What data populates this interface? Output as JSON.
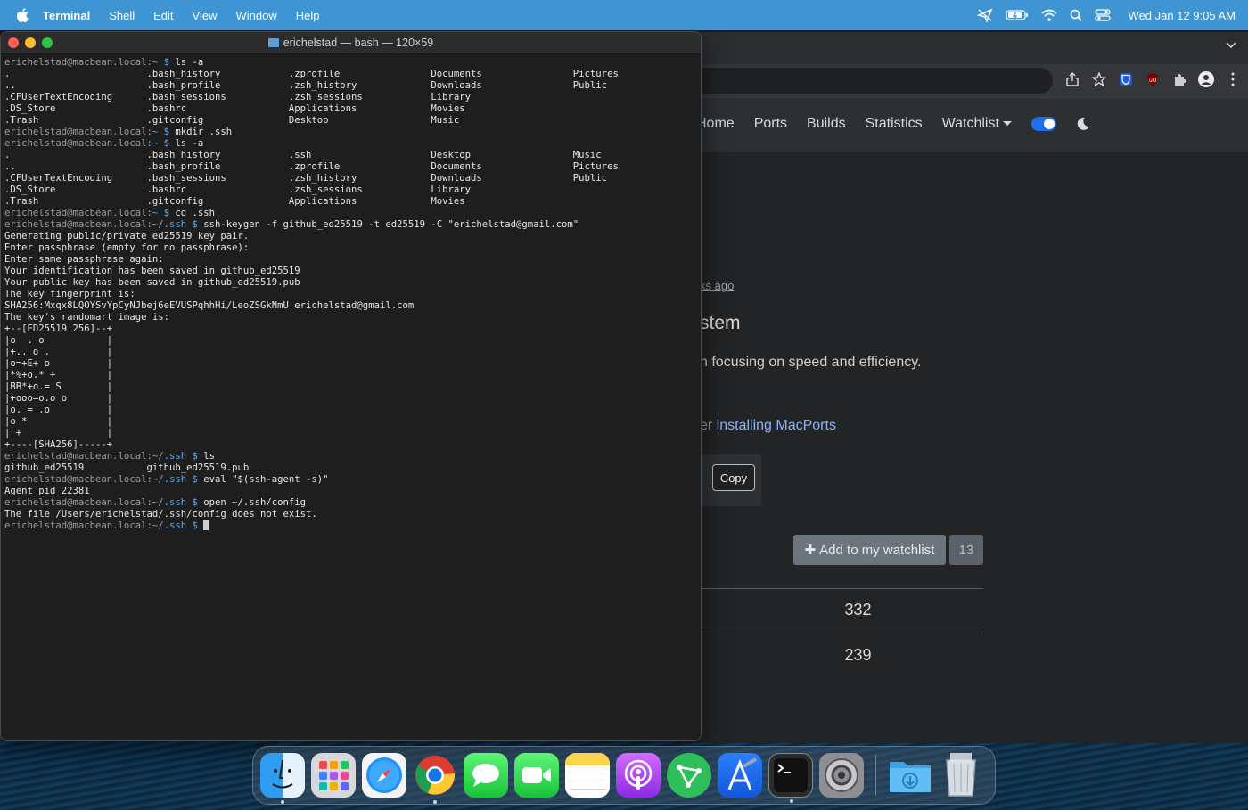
{
  "menubar": {
    "app_name": "Terminal",
    "items": [
      "Shell",
      "Edit",
      "View",
      "Window",
      "Help"
    ],
    "clock": "Wed Jan 12  9:05 AM",
    "status_icons": [
      "location-icon",
      "battery-icon",
      "wifi-icon",
      "search-icon",
      "control-center-icon"
    ]
  },
  "terminal": {
    "title": "erichelstad — bash — 120×59",
    "prompt_home_host": "erichelstad@macbean.local:",
    "lines": [
      {
        "type": "cmd",
        "path": "~",
        "cmd": "ls -a"
      },
      {
        "type": "out",
        "text": ".                        .bash_history            .zprofile                Documents                Pictures"
      },
      {
        "type": "out",
        "text": "..                       .bash_profile            .zsh_history             Downloads                Public"
      },
      {
        "type": "out",
        "text": ".CFUserTextEncoding      .bash_sessions           .zsh_sessions            Library"
      },
      {
        "type": "out",
        "text": ".DS_Store                .bashrc                  Applications             Movies"
      },
      {
        "type": "out",
        "text": ".Trash                   .gitconfig               Desktop                  Music"
      },
      {
        "type": "cmd",
        "path": "~",
        "cmd": "mkdir .ssh"
      },
      {
        "type": "cmd",
        "path": "~",
        "cmd": "ls -a"
      },
      {
        "type": "out",
        "text": ".                        .bash_history            .ssh                     Desktop                  Music"
      },
      {
        "type": "out",
        "text": "..                       .bash_profile            .zprofile                Documents                Pictures"
      },
      {
        "type": "out",
        "text": ".CFUserTextEncoding      .bash_sessions           .zsh_history             Downloads                Public"
      },
      {
        "type": "out",
        "text": ".DS_Store                .bashrc                  .zsh_sessions            Library"
      },
      {
        "type": "out",
        "text": ".Trash                   .gitconfig               Applications             Movies"
      },
      {
        "type": "cmd",
        "path": "~",
        "cmd": "cd .ssh"
      },
      {
        "type": "cmd",
        "path": "~/.ssh",
        "cmd": "ssh-keygen -f github_ed25519 -t ed25519 -C \"erichelstad@gmail.com\""
      },
      {
        "type": "out",
        "text": "Generating public/private ed25519 key pair."
      },
      {
        "type": "out",
        "text": "Enter passphrase (empty for no passphrase):"
      },
      {
        "type": "out",
        "text": "Enter same passphrase again:"
      },
      {
        "type": "out",
        "text": "Your identification has been saved in github_ed25519"
      },
      {
        "type": "out",
        "text": "Your public key has been saved in github_ed25519.pub"
      },
      {
        "type": "out",
        "text": "The key fingerprint is:"
      },
      {
        "type": "out",
        "text": "SHA256:Mxqx8LQOYSvYpCyNJbej6eEVUSPqhhHi/LeoZSGkNmU erichelstad@gmail.com"
      },
      {
        "type": "out",
        "text": "The key's randomart image is:"
      },
      {
        "type": "out",
        "text": "+--[ED25519 256]--+"
      },
      {
        "type": "out",
        "text": "|o  . o           |"
      },
      {
        "type": "out",
        "text": "|+.. o .          |"
      },
      {
        "type": "out",
        "text": "|o=+E+ o          |"
      },
      {
        "type": "out",
        "text": "|*%+o.* +         |"
      },
      {
        "type": "out",
        "text": "|BB*+o.= S        |"
      },
      {
        "type": "out",
        "text": "|+ooo=o.o o       |"
      },
      {
        "type": "out",
        "text": "|o. = .o          |"
      },
      {
        "type": "out",
        "text": "|o *              |"
      },
      {
        "type": "out",
        "text": "| +               |"
      },
      {
        "type": "out",
        "text": "+----[SHA256]-----+"
      },
      {
        "type": "cmd",
        "path": "~/.ssh",
        "cmd": "ls"
      },
      {
        "type": "out",
        "text": "github_ed25519           github_ed25519.pub"
      },
      {
        "type": "cmd",
        "path": "~/.ssh",
        "cmd": "eval \"$(ssh-agent -s)\""
      },
      {
        "type": "out",
        "text": "Agent pid 22381"
      },
      {
        "type": "cmd",
        "path": "~/.ssh",
        "cmd": "open ~/.ssh/config"
      },
      {
        "type": "out",
        "text": "The file /Users/erichelstad/.ssh/config does not exist."
      },
      {
        "type": "active",
        "path": "~/.ssh",
        "cmd": ""
      }
    ]
  },
  "browser": {
    "nav": [
      "Home",
      "Ports",
      "Builds",
      "Statistics",
      "Watchlist"
    ],
    "weeks_ago": "ks ago",
    "heading": "stem",
    "description": "n focusing on speed and efficiency.",
    "install_prefix": "er ",
    "install_link": "installing MacPorts",
    "copy_label": "Copy",
    "watchlist_button": "Add to my watchlist",
    "watchlist_count": "13",
    "stat1": "332",
    "stat2": "239"
  },
  "dock": {
    "apps": [
      "finder-icon",
      "launchpad-icon",
      "safari-icon",
      "chrome-icon",
      "messages-icon",
      "facetime-icon",
      "notes-icon",
      "podcasts-icon",
      "vector-app-icon",
      "xcode-icon",
      "terminal-icon",
      "system-preferences-icon",
      "downloads-folder-icon",
      "trash-icon"
    ]
  },
  "colors": {
    "menubar": "#3f95d4",
    "terminal_bg": "#1e1e1e",
    "prompt_path": "#6aa8e8",
    "link": "#8ab4f8"
  }
}
